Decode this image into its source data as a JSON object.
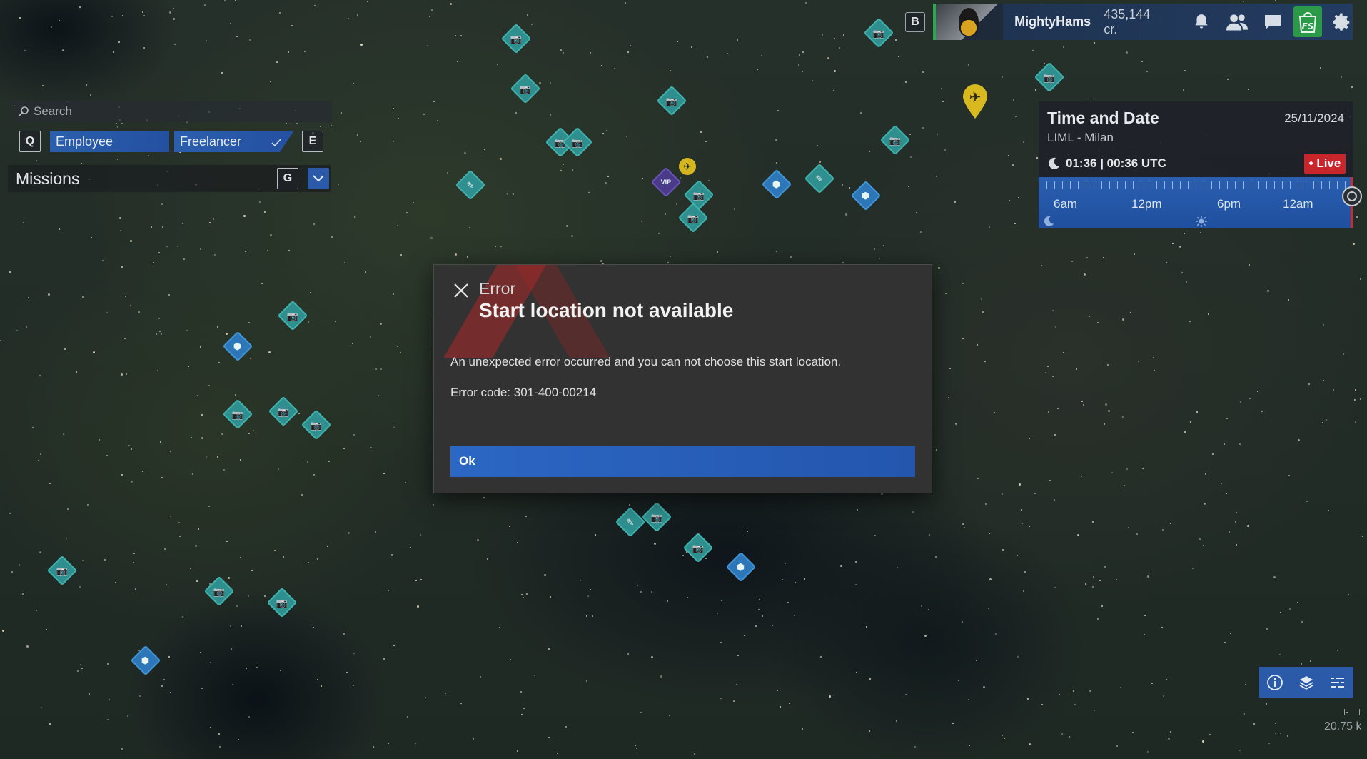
{
  "header": {
    "key_b": "B",
    "username": "MightyHams",
    "credits": "435,144 cr.",
    "icons": [
      "bell-icon",
      "friends-icon",
      "chat-icon",
      "fs-shop-icon",
      "gear-icon"
    ]
  },
  "left_panel": {
    "search_placeholder": "Search",
    "key_q": "Q",
    "key_e": "E",
    "key_g": "G",
    "tabs": [
      {
        "label": "Employee"
      },
      {
        "label": "Freelancer"
      }
    ],
    "missions_label": "Missions"
  },
  "time_widget": {
    "title": "Time and Date",
    "date": "25/11/2024",
    "location": "LIML - Milan",
    "time": "01:36 | 00:36 UTC",
    "live_label": "• Live",
    "ticks": [
      "6am",
      "12pm",
      "6pm",
      "12am"
    ]
  },
  "dialog": {
    "label": "Error",
    "title": "Start location not available",
    "message": "An unexpected error occurred and you can not choose this start location.",
    "error_code": "Error code: 301-400-00214",
    "ok_label": "Ok"
  },
  "map": {
    "marker_vip_label": "VIP",
    "scale": "20.75 k"
  },
  "colors": {
    "accent_blue": "#2b67c4",
    "live_red": "#c9262c",
    "marker_teal": "#2f8f8e",
    "marker_blue": "#2d77b9",
    "fs_green": "#2a9a48"
  }
}
